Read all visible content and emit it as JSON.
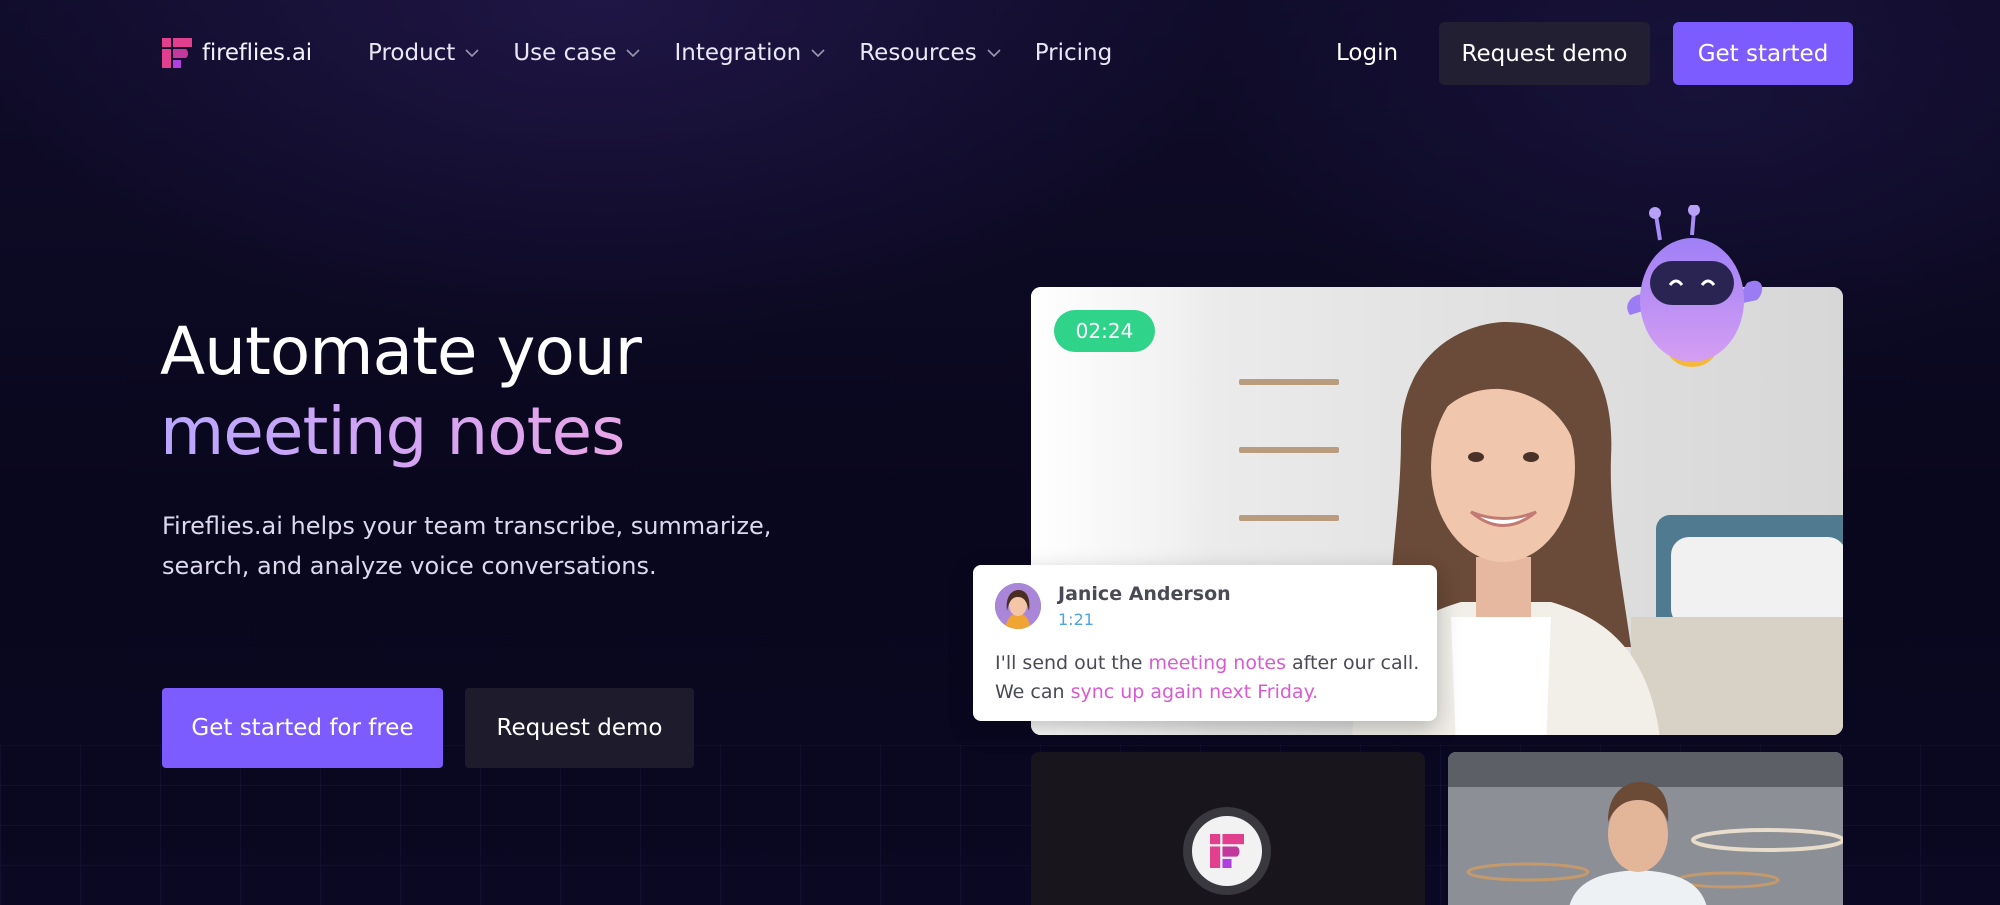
{
  "brand": {
    "name": "fireflies.ai",
    "accent": "#7c5cff",
    "logo_colors": [
      "#e2408f",
      "#b23fe0"
    ]
  },
  "nav": {
    "items": [
      {
        "label": "Product",
        "has_dropdown": true
      },
      {
        "label": "Use case",
        "has_dropdown": true
      },
      {
        "label": "Integration",
        "has_dropdown": true
      },
      {
        "label": "Resources",
        "has_dropdown": true
      },
      {
        "label": "Pricing",
        "has_dropdown": false
      }
    ],
    "login_label": "Login",
    "request_demo_label": "Request demo",
    "get_started_label": "Get started"
  },
  "hero": {
    "title_line1": "Automate your",
    "title_line2": "meeting notes",
    "subtitle": "Fireflies.ai helps your team transcribe, summarize, search, and analyze voice conversations.",
    "cta_primary": "Get started for free",
    "cta_secondary": "Request demo"
  },
  "video": {
    "timer": "02:24",
    "timer_color": "#2fd38a"
  },
  "transcript_card": {
    "speaker": "Janice Anderson",
    "timestamp": "1:21",
    "text_part1": "I'll send out the ",
    "highlight1": "meeting notes",
    "text_part2": " after our call. We can ",
    "highlight2": "sync up again next Friday.",
    "highlight_color": "#d85bd1"
  }
}
